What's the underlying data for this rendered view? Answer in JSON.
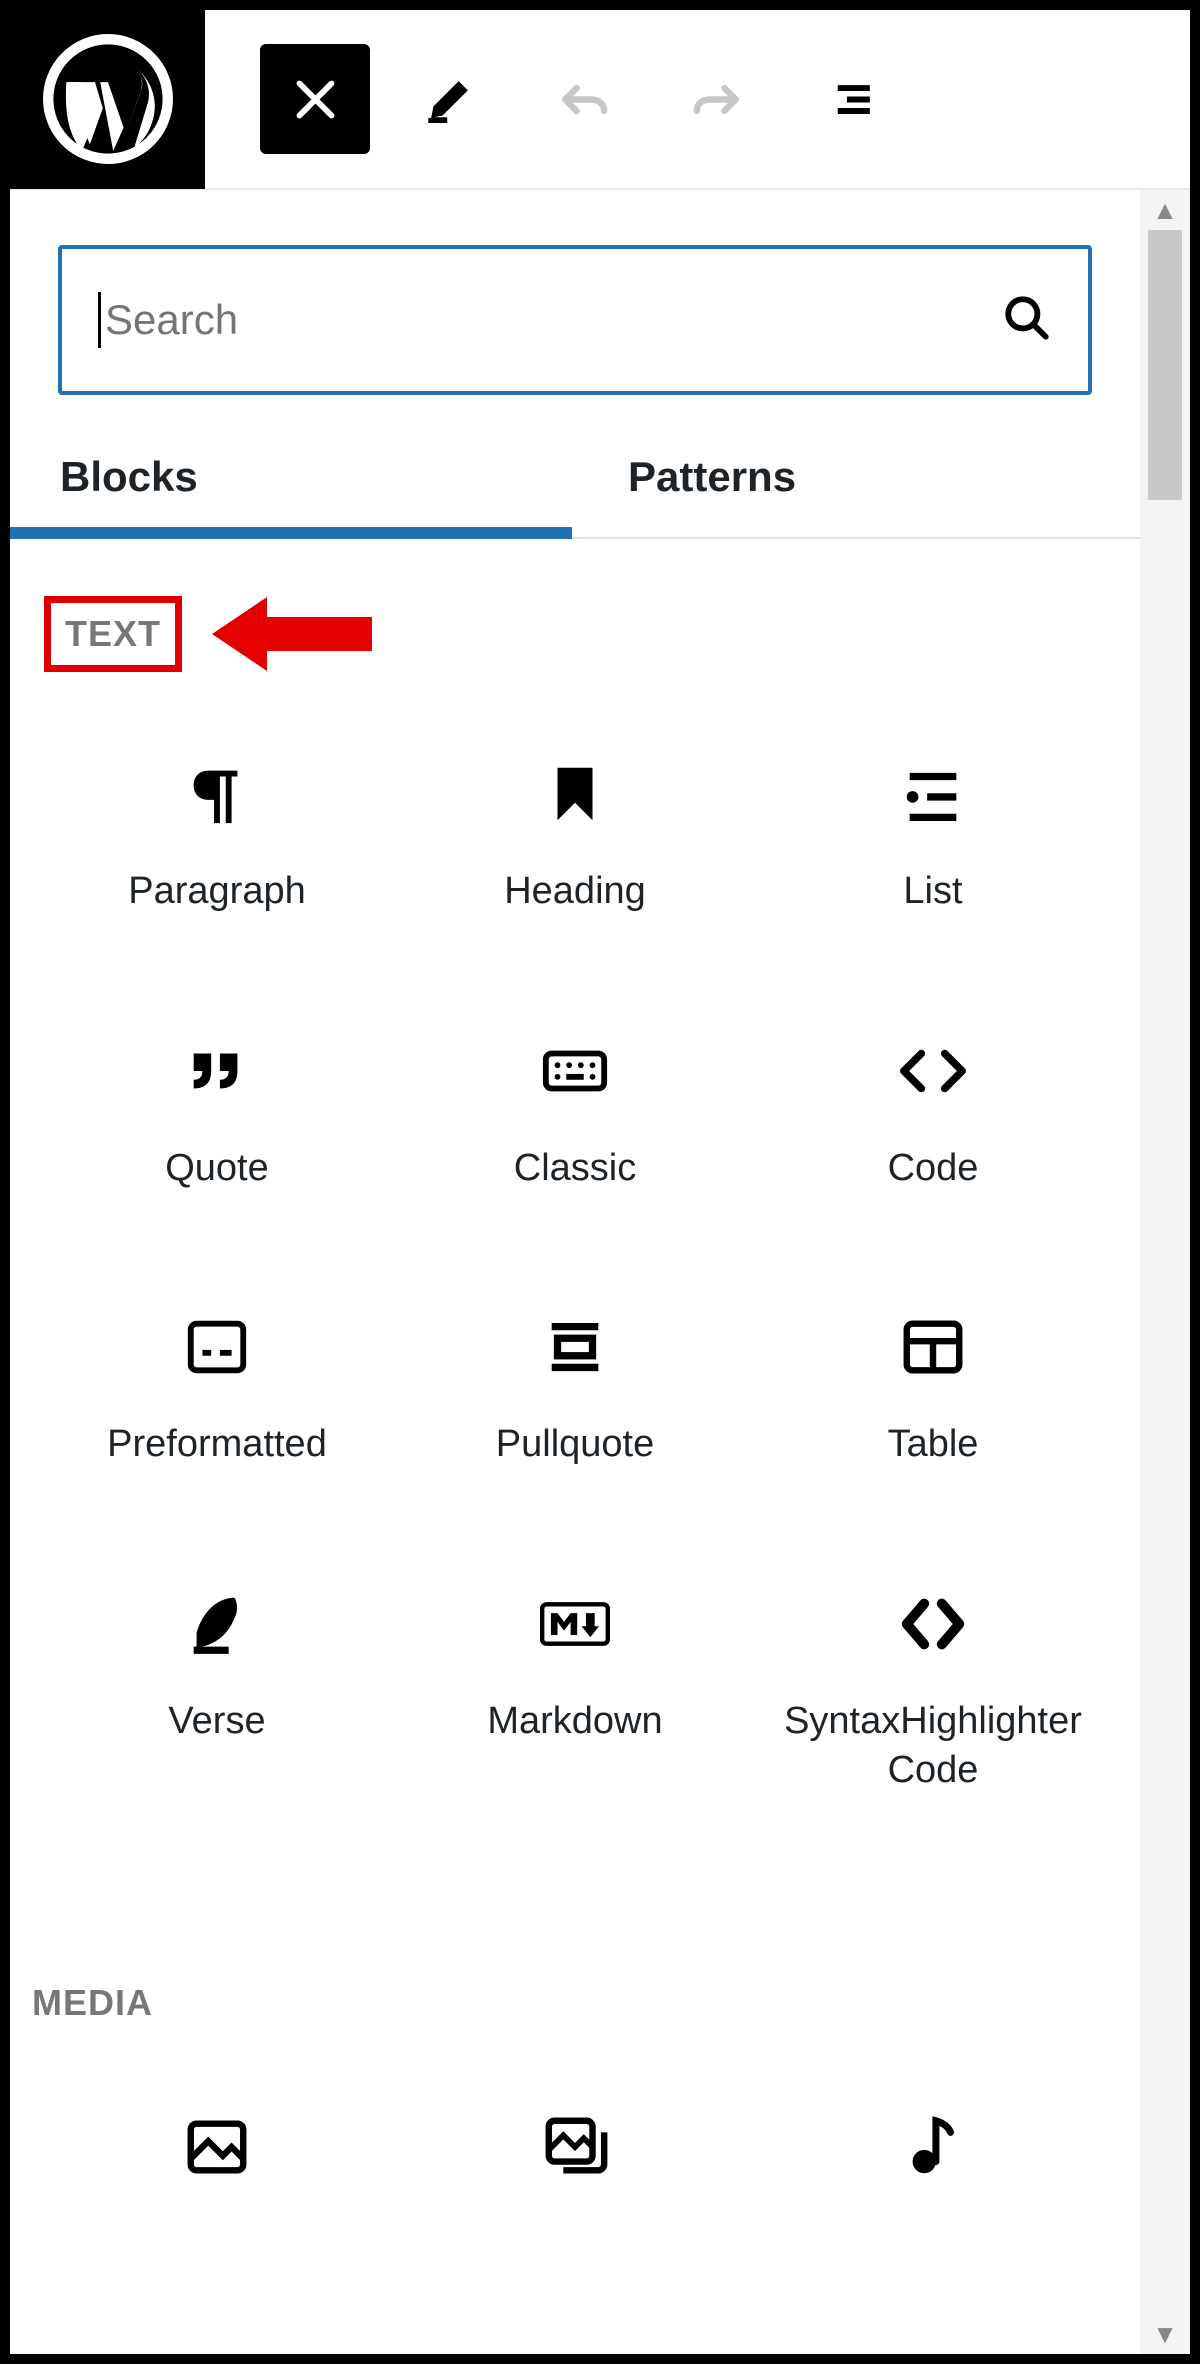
{
  "toolbar": {
    "close_label": "Close inserter",
    "edit_label": "Edit",
    "undo_label": "Undo",
    "redo_label": "Redo",
    "details_label": "Details"
  },
  "search": {
    "placeholder": "Search"
  },
  "tabs": {
    "blocks": "Blocks",
    "patterns": "Patterns",
    "active": "blocks"
  },
  "categories": [
    {
      "id": "text",
      "label": "TEXT",
      "highlighted": true,
      "blocks": [
        {
          "id": "paragraph",
          "label": "Paragraph",
          "icon": "pilcrow"
        },
        {
          "id": "heading",
          "label": "Heading",
          "icon": "bookmark"
        },
        {
          "id": "list",
          "label": "List",
          "icon": "list"
        },
        {
          "id": "quote",
          "label": "Quote",
          "icon": "quote"
        },
        {
          "id": "classic",
          "label": "Classic",
          "icon": "keyboard"
        },
        {
          "id": "code",
          "label": "Code",
          "icon": "anglebrackets"
        },
        {
          "id": "preformatted",
          "label": "Preformatted",
          "icon": "preformatted"
        },
        {
          "id": "pullquote",
          "label": "Pullquote",
          "icon": "pullquote"
        },
        {
          "id": "table",
          "label": "Table",
          "icon": "table"
        },
        {
          "id": "verse",
          "label": "Verse",
          "icon": "feather"
        },
        {
          "id": "markdown",
          "label": "Markdown",
          "icon": "markdown"
        },
        {
          "id": "syntax",
          "label": "SyntaxHighlighter Code",
          "icon": "anglebrackets-bold"
        }
      ]
    },
    {
      "id": "media",
      "label": "MEDIA",
      "highlighted": false,
      "blocks": [
        {
          "id": "image",
          "label": "",
          "icon": "image"
        },
        {
          "id": "gallery",
          "label": "",
          "icon": "gallery"
        },
        {
          "id": "audio",
          "label": "",
          "icon": "audio"
        }
      ]
    }
  ],
  "annotation": {
    "points_to": "text-category"
  }
}
